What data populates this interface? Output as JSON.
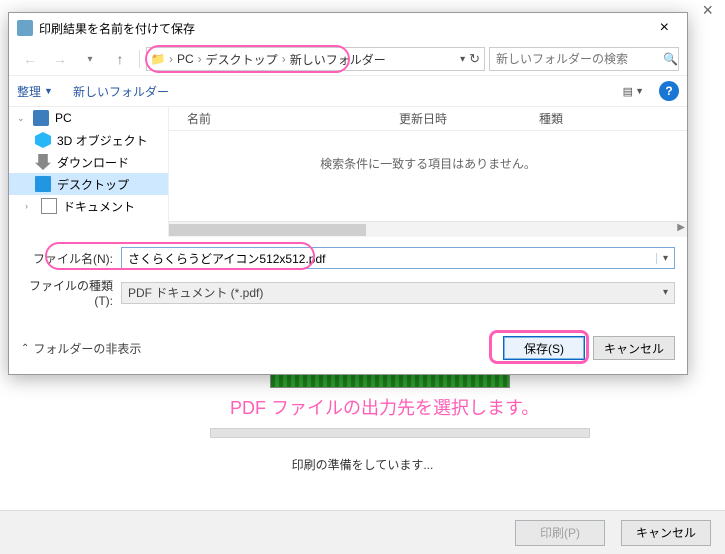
{
  "dialog": {
    "title": "印刷結果を名前を付けて保存",
    "breadcrumb": {
      "seg1": "PC",
      "seg2": "デスクトップ",
      "seg3": "新しいフォルダー"
    },
    "search_placeholder": "新しいフォルダーの検索",
    "toolbar": {
      "organize": "整理",
      "new_folder": "新しいフォルダー"
    },
    "tree": {
      "pc": "PC",
      "objects3d": "3D オブジェクト",
      "downloads": "ダウンロード",
      "desktop": "デスクトップ",
      "documents": "ドキュメント"
    },
    "list": {
      "col_name": "名前",
      "col_date": "更新日時",
      "col_type": "種類",
      "empty": "検索条件に一致する項目はありません。"
    },
    "filename_label": "ファイル名(N):",
    "filename_value": "さくらくらうどアイコン512x512.pdf",
    "filetype_label": "ファイルの種類(T):",
    "filetype_value": "PDF ドキュメント (*.pdf)",
    "hide_folders": "フォルダーの非表示",
    "save": "保存(S)",
    "cancel": "キャンセル"
  },
  "annotation_caption": "PDF ファイルの出力先を選択します。",
  "status_text": "印刷の準備をしています...",
  "footer": {
    "print": "印刷(P)",
    "cancel": "キャンセル"
  }
}
